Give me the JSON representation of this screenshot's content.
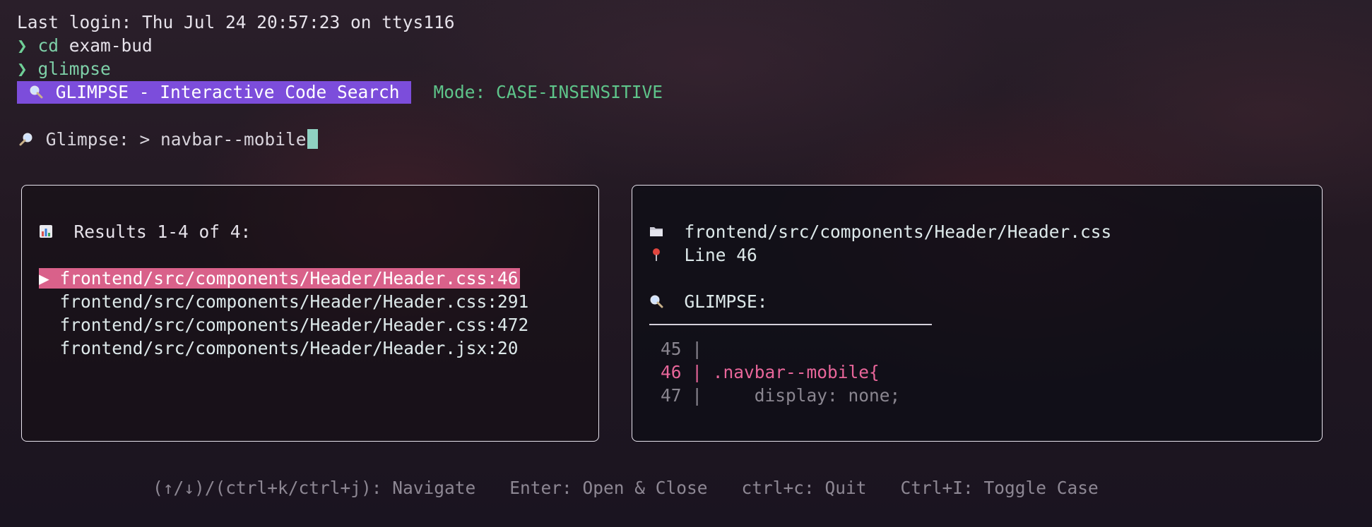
{
  "terminal": {
    "last_login": "Last login: Thu Jul 24 20:57:23 on ttys116",
    "prompt_symbol": "❯",
    "cmd1_name": "cd",
    "cmd1_arg": " exam-bud",
    "cmd2_name": "glimpse"
  },
  "banner": {
    "icon": "magnifier-icon",
    "title": "GLIMPSE - Interactive Code Search",
    "mode": "Mode: CASE-INSENSITIVE"
  },
  "search": {
    "icon": "magnifier-tilted-icon",
    "label": "Glimpse: > ",
    "query": "navbar--mobile"
  },
  "results": {
    "icon": "bar-chart-icon",
    "heading": "Results 1-4 of 4:",
    "selected_marker": "▶",
    "items": [
      "frontend/src/components/Header/Header.css:46",
      "frontend/src/components/Header/Header.css:291",
      "frontend/src/components/Header/Header.css:472",
      "frontend/src/components/Header/Header.jsx:20"
    ]
  },
  "preview": {
    "folder_icon": "folder-icon",
    "file_path": "frontend/src/components/Header/Header.css",
    "pin_icon": "pushpin-icon",
    "line_label": "Line 46",
    "section_icon": "magnifier-icon",
    "section_label": "GLIMPSE:",
    "code_lines": [
      {
        "num": "45",
        "sep": " |",
        "code": ""
      },
      {
        "num": "46",
        "sep": " |",
        "code": " .navbar--mobile{"
      },
      {
        "num": "47",
        "sep": " |",
        "code": "     display: none;"
      }
    ]
  },
  "footer": {
    "navigate": "(↑/↓)/(ctrl+k/ctrl+j): Navigate",
    "open": "Enter: Open & Close",
    "quit": "ctrl+c: Quit",
    "toggle": "Ctrl+I: Toggle Case"
  },
  "colors": {
    "banner_bg": "#7c4ddb",
    "selected_bg": "#d9618a",
    "mode_green": "#5ec48a",
    "highlight_pink": "#e8669a",
    "cursor": "#8fd1c2"
  }
}
